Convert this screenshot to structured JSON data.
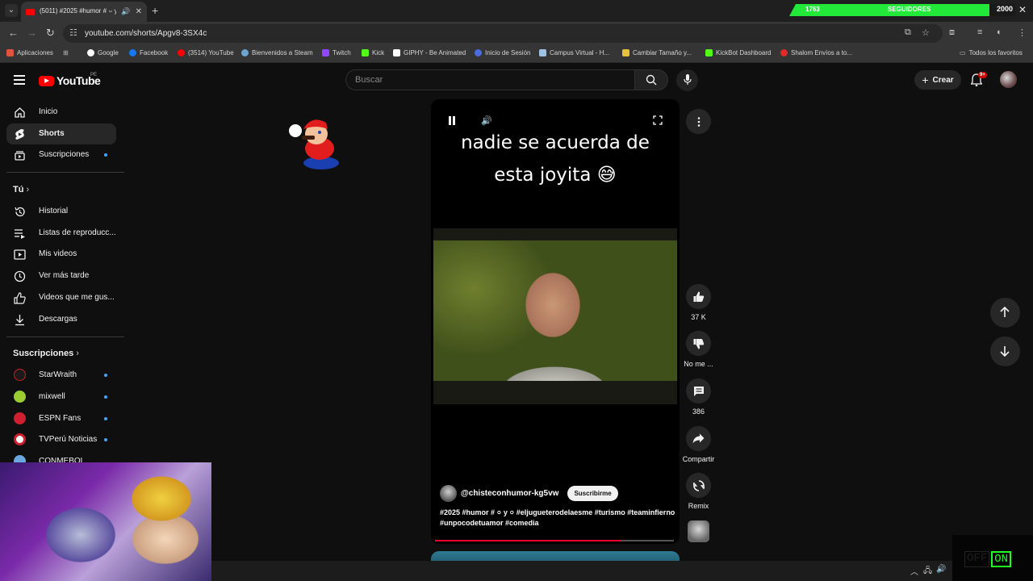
{
  "browser": {
    "tab_title": "(5011) #2025 #humor # ০ y ০",
    "url": "youtube.com/shorts/Apgv8-3SX4c",
    "stream_count": "1763",
    "stream_label": "SEGUIDORES",
    "stream_goal": "2000",
    "bookmarks": [
      "Aplicaciones",
      "Google",
      "Facebook",
      "(3514) YouTube",
      "Bienvenidos a Steam",
      "Twitch",
      "Kick",
      "GIPHY - Be Animated",
      "Inicio de Sesión",
      "Campus Virtual - H...",
      "Cambiar Tamaño y...",
      "KickBot Dashboard",
      "Shalom Envíos a to..."
    ],
    "all_bookmarks": "Todos los favoritos"
  },
  "header": {
    "logo_text": "YouTube",
    "country": "PE",
    "search_placeholder": "Buscar",
    "create_label": "Crear",
    "notif_badge": "9+"
  },
  "sidebar": {
    "main": [
      "Inicio",
      "Shorts",
      "Suscripciones"
    ],
    "you_title": "Tú",
    "you_items": [
      "Historial",
      "Listas de reproducc...",
      "Mis videos",
      "Ver más tarde",
      "Videos que me gus...",
      "Descargas"
    ],
    "subs_title": "Suscripciones",
    "subs": [
      "StarWraith",
      "mixwell",
      "ESPN Fans",
      "TVPerú Noticias",
      "CONMEBOL"
    ]
  },
  "short": {
    "caption_line1": "nadie se acuerda de",
    "caption_line2": "esta joyita 😅",
    "channel": "@chisteconhumor-kg5vw",
    "subscribe": "Suscribirme",
    "tags_line1": "#2025 #humor # ০ y ০  #eljugueterodelaesme #turismo #teaminfierno",
    "tags_line2": "#unpocodetuamor #comedia",
    "progress": 0.78
  },
  "actions": {
    "likes": "37 K",
    "dislike": "No me ...",
    "comments": "386",
    "share": "Compartir",
    "remix": "Remix"
  },
  "overlay": {
    "off": "OFF",
    "on": "ON"
  }
}
